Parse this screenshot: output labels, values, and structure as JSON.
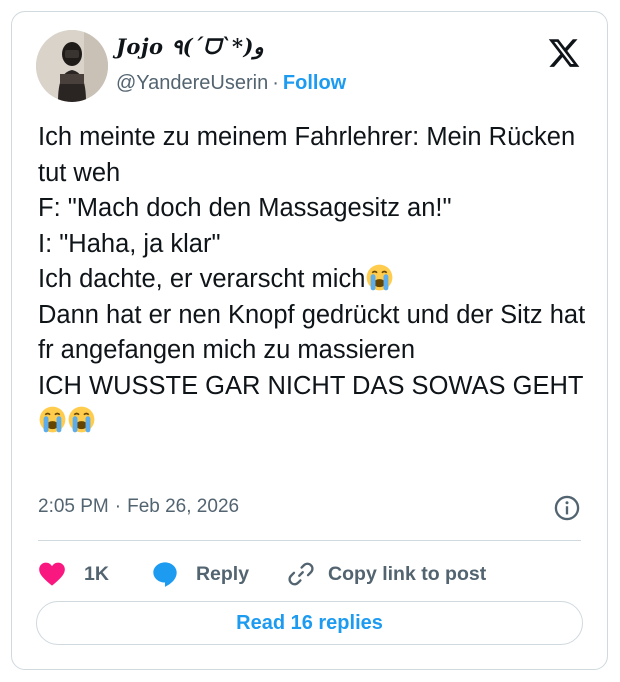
{
  "author": {
    "display_name": "Jojo ٩(ˊᗜˋ*)و",
    "handle": "@YandereUserin",
    "separator": "·",
    "follow_label": "Follow",
    "avatar_icon": "profile-photo"
  },
  "tweet": {
    "line1": "Ich meinte zu meinem Fahrlehrer: Mein Rücken tut weh",
    "line2": "F: \"Mach doch den Massagesitz an!\"",
    "line3": "I: \"Haha, ja klar\"",
    "line4": "Ich dachte, er verarscht mich",
    "line5": "Dann hat er nen Knopf gedrückt und der Sitz hat fr angefangen mich zu massieren",
    "line6": "ICH WUSSTE GAR NICHT DAS SOWAS GEHT",
    "emoji_icon": "loudly-crying-face"
  },
  "meta": {
    "time": "2:05 PM",
    "separator": "·",
    "date": "Feb 26, 2026"
  },
  "actions": {
    "like_count": "1K",
    "reply_label": "Reply",
    "copy_label": "Copy link to post"
  },
  "read_replies_label": "Read 16 replies",
  "colors": {
    "accent": "#1d9bf0",
    "like": "#f91880",
    "text": "#0f1419",
    "secondary": "#536471",
    "border": "#cfd9de"
  }
}
